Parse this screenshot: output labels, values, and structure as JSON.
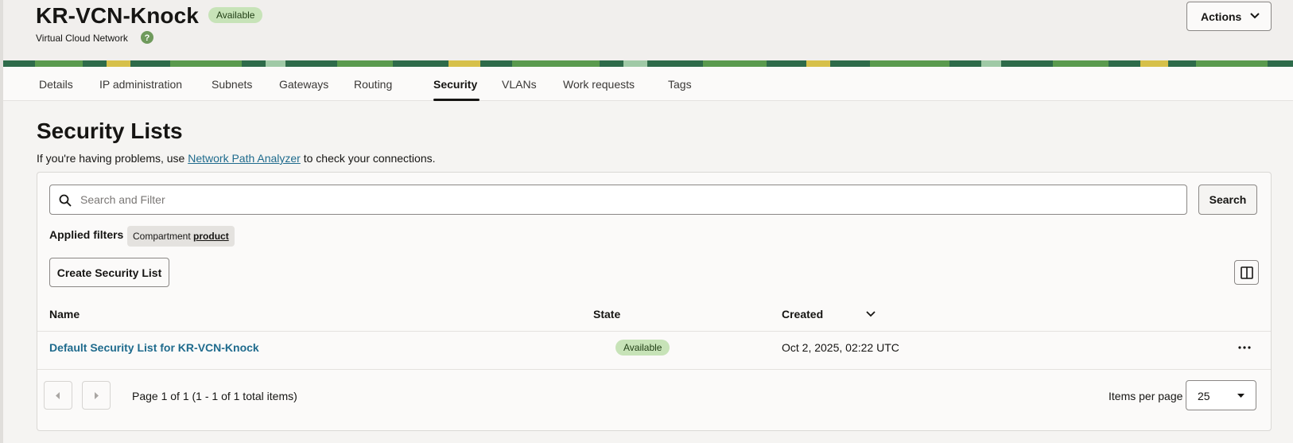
{
  "header": {
    "title": "KR-VCN-Knock",
    "status": "Available",
    "subtitle": "Virtual Cloud Network",
    "actions_label": "Actions"
  },
  "tabs": [
    {
      "label": "Details"
    },
    {
      "label": "IP administration"
    },
    {
      "label": "Subnets"
    },
    {
      "label": "Gateways"
    },
    {
      "label": "Routing"
    },
    {
      "label": "Security"
    },
    {
      "label": "VLANs"
    },
    {
      "label": "Work requests"
    },
    {
      "label": "Tags"
    }
  ],
  "active_tab": "Security",
  "main": {
    "heading": "Security Lists",
    "help_prefix": "If you're having problems, use ",
    "help_link": "Network Path Analyzer",
    "help_suffix": " to check your connections.",
    "search_placeholder": "Search and Filter",
    "search_button": "Search",
    "applied_filters_label": "Applied filters",
    "filter_chip": {
      "key": "Compartment",
      "value": "product"
    },
    "create_button": "Create Security List",
    "table": {
      "columns": [
        "Name",
        "State",
        "Created"
      ],
      "rows": [
        {
          "name": "Default Security List for KR-VCN-Knock",
          "state": "Available",
          "created": "Oct 2, 2025, 02:22 UTC"
        }
      ]
    },
    "pagination": {
      "info": "Page 1 of 1 (1 - 1 of 1 total items)",
      "items_per_page_label": "Items per page",
      "items_per_page_value": "25"
    }
  },
  "colors": {
    "accent_link": "#1f6b8d",
    "badge_bg": "#c7e3b8",
    "background": "#f5f4f2"
  }
}
